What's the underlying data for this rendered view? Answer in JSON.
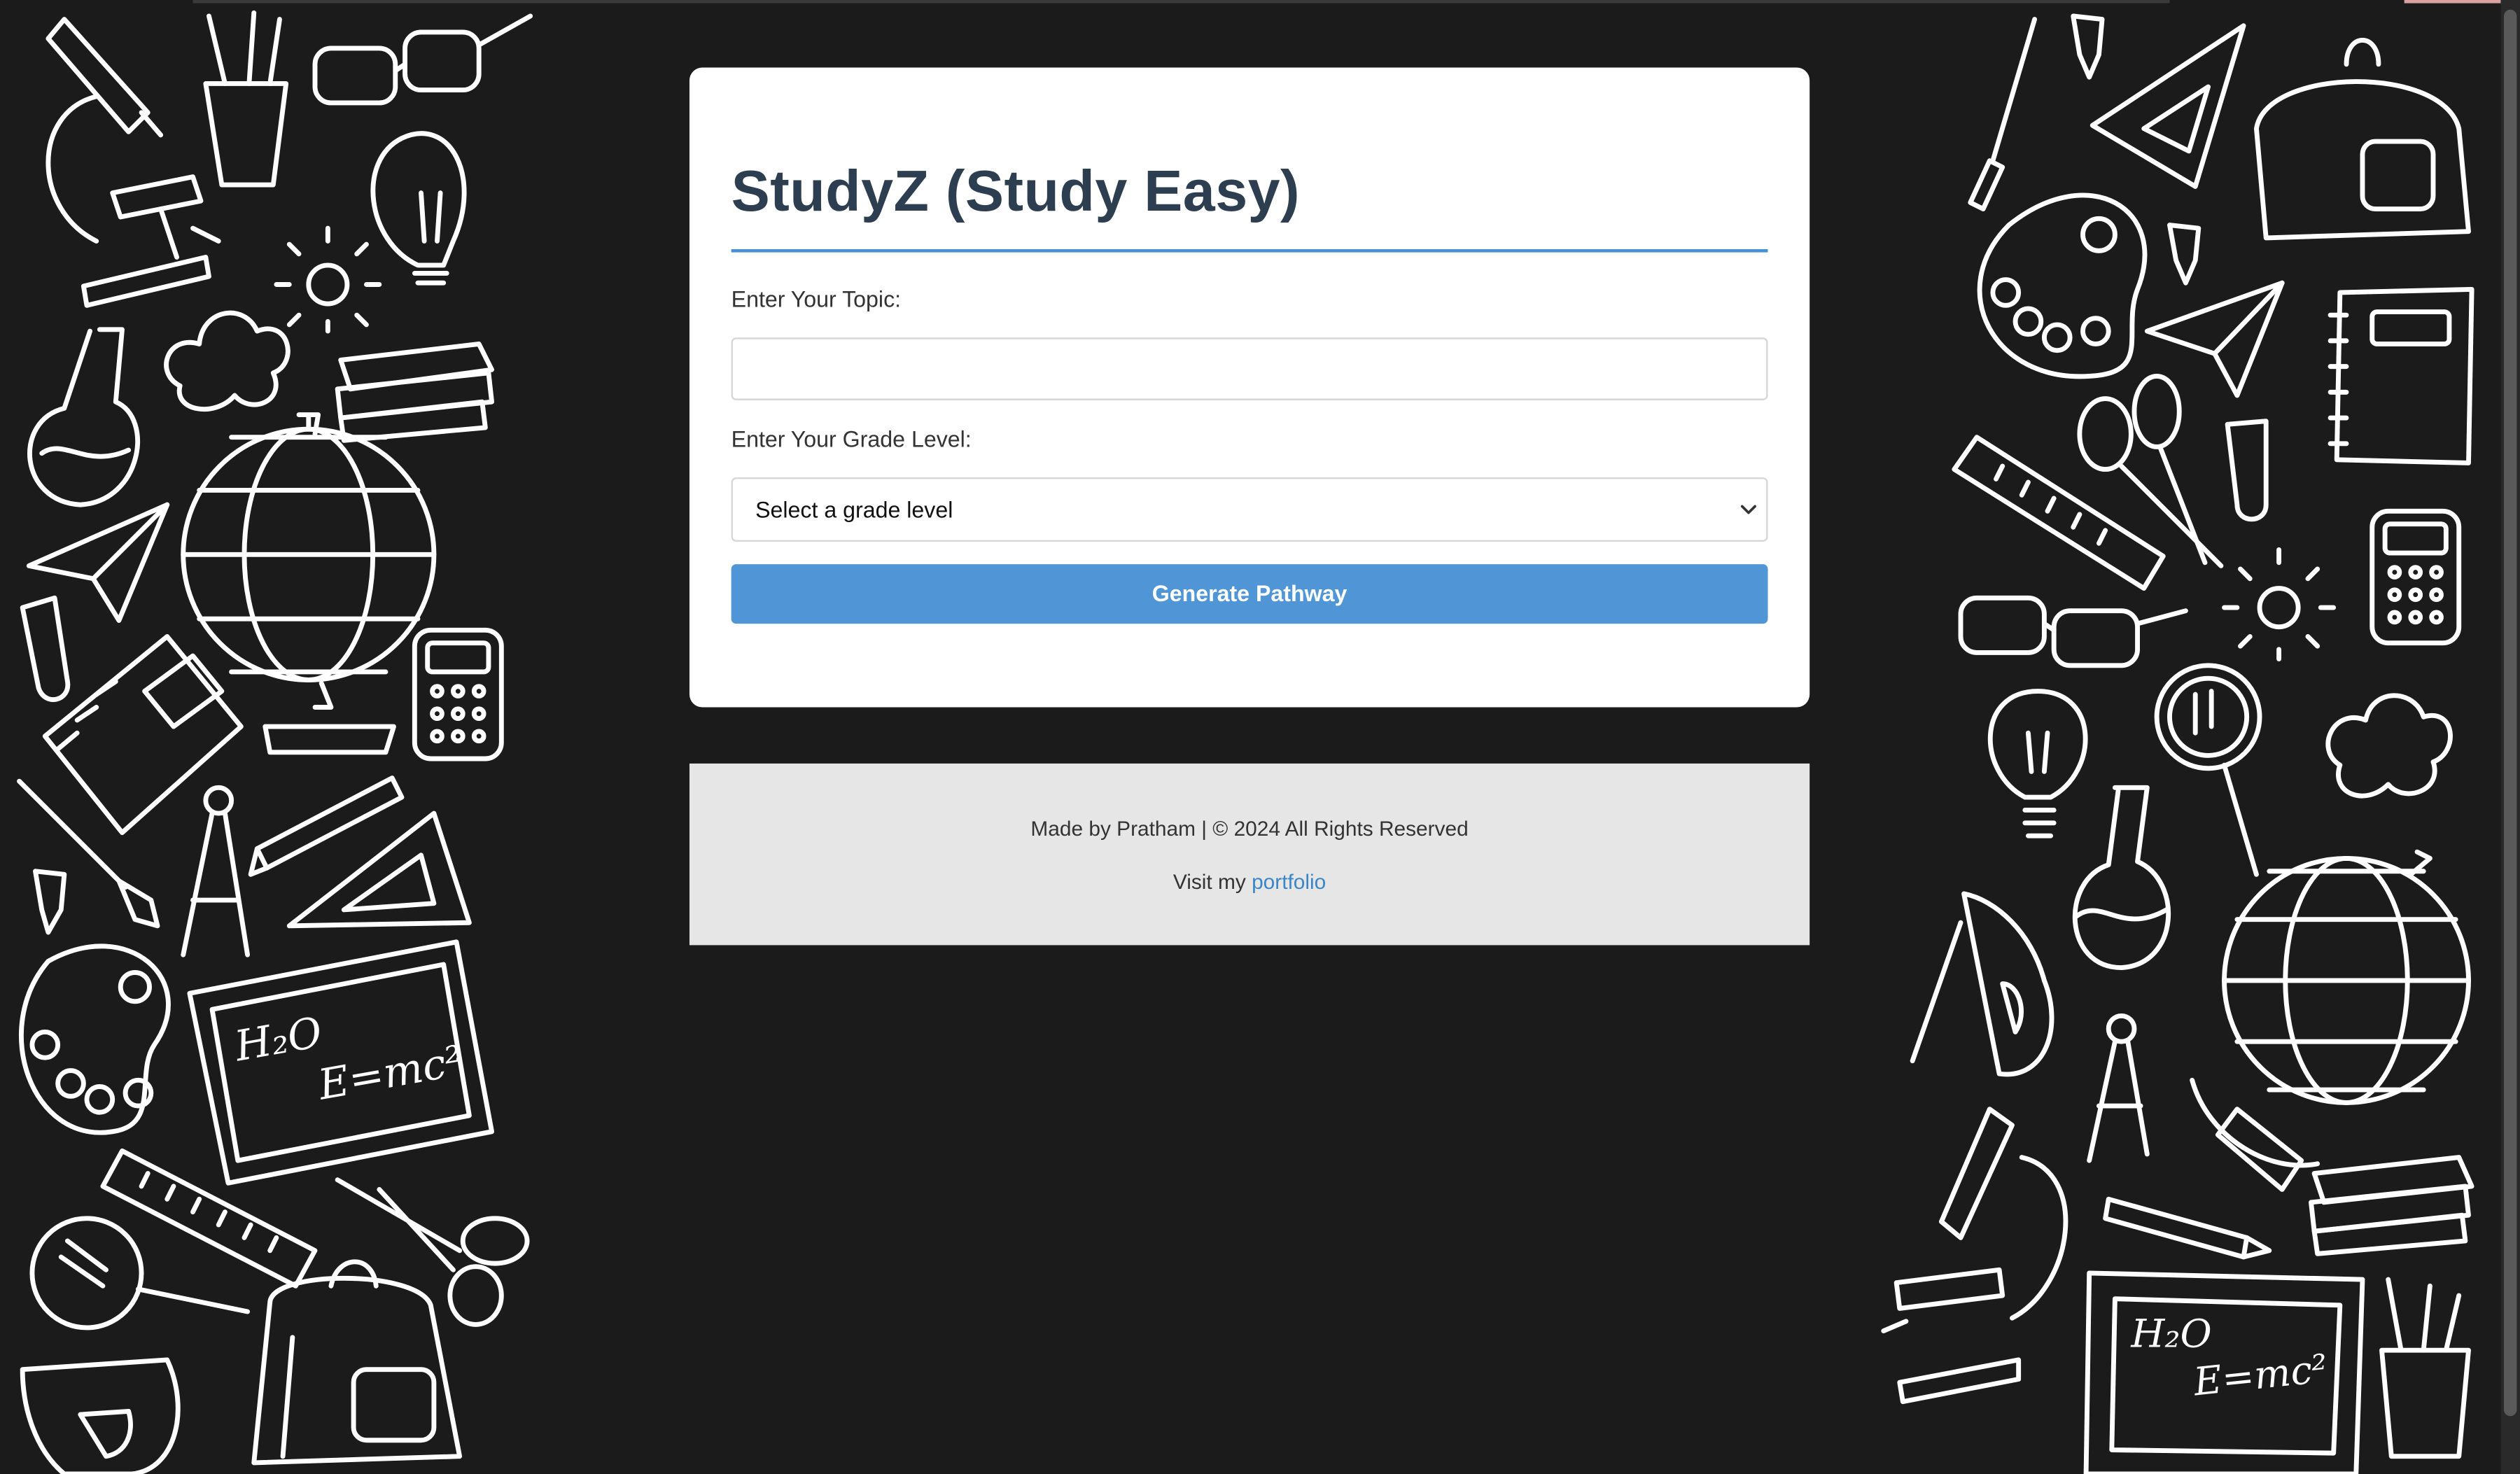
{
  "app": {
    "title": "StudyZ (Study Easy)"
  },
  "form": {
    "topic_label": "Enter Your Topic:",
    "topic_value": "",
    "grade_label": "Enter Your Grade Level:",
    "grade_selected": "Select a grade level",
    "generate_label": "Generate Pathway"
  },
  "footer": {
    "credit": "Made by Pratham | © 2024 All Rights Reserved",
    "visit_prefix": "Visit my",
    "portfolio_link": "portfolio"
  },
  "doodles": {
    "formula_water": "H₂O",
    "formula_energy": "E=mc²"
  },
  "colors": {
    "background": "#1b1b1b",
    "card": "#ffffff",
    "title": "#2c3e50",
    "accent": "#4a90d6",
    "button": "#5096d6",
    "footer_bg": "#e6e6e6",
    "link": "#3a86c8"
  },
  "icons": {
    "select_arrow": "chevron-down-icon"
  }
}
